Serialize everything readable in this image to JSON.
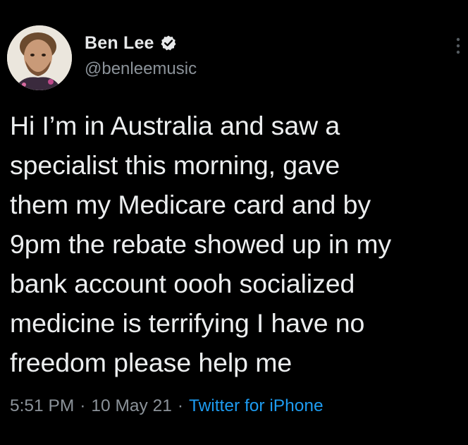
{
  "user": {
    "display_name": "Ben Lee",
    "handle": "@benleemusic",
    "verified": true
  },
  "tweet": {
    "text": "Hi I’m in Australia and saw a\nspecialist this morning, gave\nthem my Medicare card and by\n9pm the rebate showed up in my\nbank account oooh socialized\nmedicine is terrifying I have no\nfreedom please help me",
    "time": "5:51 PM",
    "date": "10 May 21",
    "separator": "·",
    "source": "Twitter for iPhone"
  },
  "icons": {
    "verified": "verified-badge-icon",
    "more": "more-options-icon"
  },
  "colors": {
    "background": "#000000",
    "text": "#e7e9ea",
    "secondary": "#8b9299",
    "link": "#1d9bf0"
  }
}
